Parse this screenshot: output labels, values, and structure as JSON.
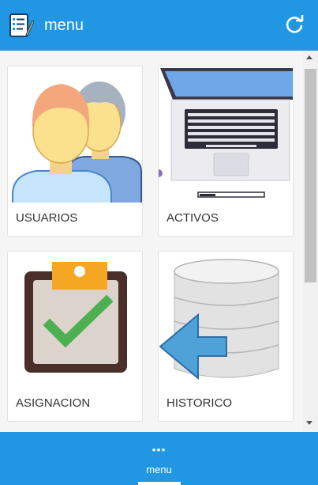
{
  "header": {
    "title": "menu"
  },
  "cards": [
    {
      "label": "USUARIOS"
    },
    {
      "label": "ACTIVOS"
    },
    {
      "label": "ASIGNACION"
    },
    {
      "label": "HISTORICO"
    }
  ],
  "footer": {
    "dots": "•••",
    "label": "menu"
  },
  "colors": {
    "primary": "#2196e3",
    "card_border": "#e3e3e3",
    "check_green": "#4caf50",
    "clip_orange": "#f5a623"
  },
  "icons": [
    "checklist-icon",
    "refresh-icon",
    "users-icon",
    "laptop-icon",
    "clipboard-check-icon",
    "database-history-icon",
    "more-dots-icon"
  ]
}
